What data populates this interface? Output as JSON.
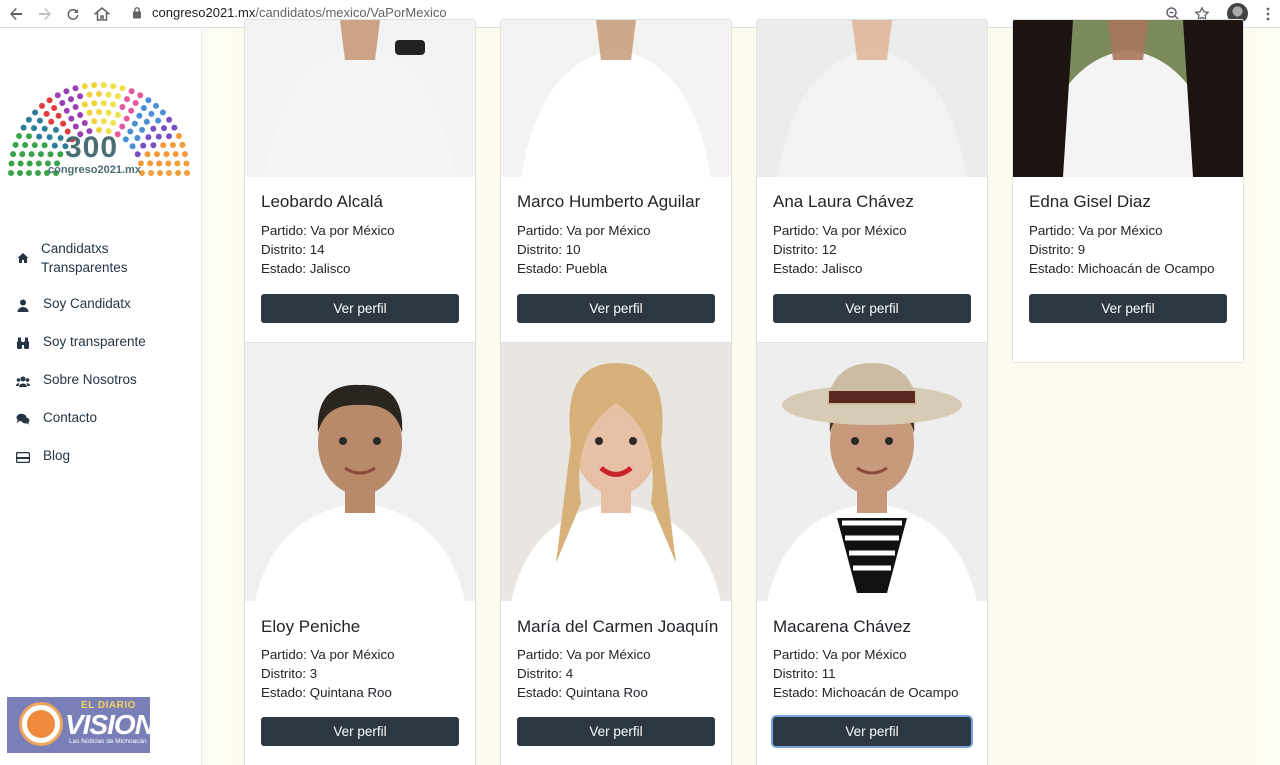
{
  "browser": {
    "url_domain": "congreso2021.mx",
    "url_path": "/candidatos/mexico/VaPorMexico"
  },
  "sidebar": {
    "logo_number": "300",
    "logo_site": "congreso2021.mx",
    "items": [
      {
        "label": "Candidatxs Transparentes",
        "icon": "home-icon"
      },
      {
        "label": "Soy Candidatx",
        "icon": "user-icon"
      },
      {
        "label": "Soy transparente",
        "icon": "binoculars-icon"
      },
      {
        "label": "Sobre Nosotros",
        "icon": "users-icon"
      },
      {
        "label": "Contacto",
        "icon": "comments-icon"
      },
      {
        "label": "Blog",
        "icon": "card-icon"
      }
    ],
    "badge": {
      "top": "EL DIARIO",
      "main": "VISION",
      "sub": "Las Noticias de Michoacán"
    }
  },
  "candidates": [
    {
      "name": "Leobardo Alcalá",
      "partido": "Partido: Va por México",
      "distrito": "Distrito: 14",
      "estado": "Estado: Jalisco",
      "button": "Ver perfil"
    },
    {
      "name": "Marco Humberto Aguilar",
      "partido": "Partido: Va por México",
      "distrito": "Distrito: 10",
      "estado": "Estado: Puebla",
      "button": "Ver perfil"
    },
    {
      "name": "Ana Laura Chávez",
      "partido": "Partido: Va por México",
      "distrito": "Distrito: 12",
      "estado": "Estado: Jalisco",
      "button": "Ver perfil"
    },
    {
      "name": "Edna Gisel Diaz",
      "partido": "Partido: Va por México",
      "distrito": "Distrito: 9",
      "estado": "Estado: Michoacán de Ocampo",
      "button": "Ver perfil"
    },
    {
      "name": "Eloy Peniche",
      "partido": "Partido: Va por México",
      "distrito": "Distrito: 3",
      "estado": "Estado: Quintana Roo",
      "button": "Ver perfil"
    },
    {
      "name": "María del Carmen Joaquín",
      "partido": "Partido: Va por México",
      "distrito": "Distrito: 4",
      "estado": "Estado: Quintana Roo",
      "button": "Ver perfil"
    },
    {
      "name": "Macarena Chávez",
      "partido": "Partido: Va por México",
      "distrito": "Distrito: 11",
      "estado": "Estado: Michoacán de Ocampo",
      "button": "Ver perfil"
    }
  ]
}
